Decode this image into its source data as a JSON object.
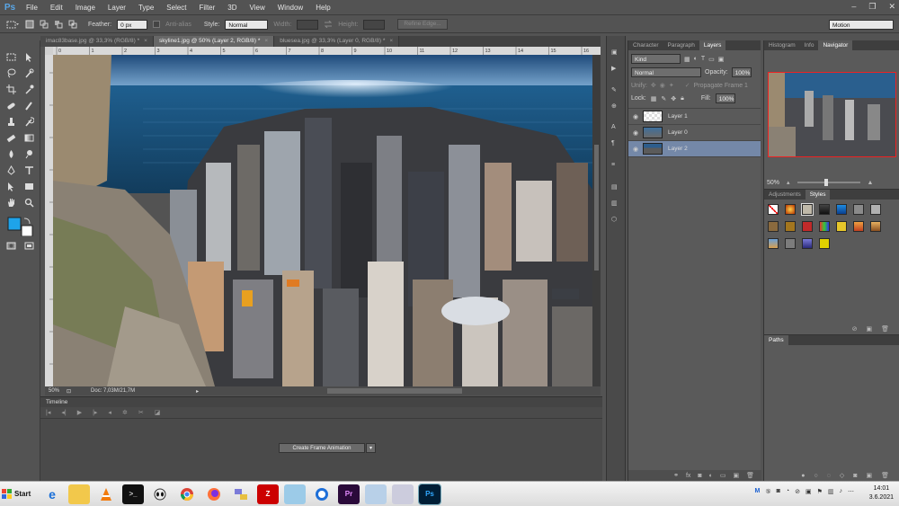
{
  "app": {
    "logo": "Ps"
  },
  "menu": [
    "File",
    "Edit",
    "Image",
    "Layer",
    "Type",
    "Select",
    "Filter",
    "3D",
    "View",
    "Window",
    "Help"
  ],
  "window_controls": [
    "–",
    "❐",
    "✕"
  ],
  "options": {
    "feather_label": "Feather:",
    "feather_value": "0 px",
    "antialias_label": "Anti-alias",
    "style_label": "Style:",
    "style_value": "Normal",
    "width_label": "Width:",
    "height_label": "Height:",
    "refine_edge": "Refine Edge...",
    "workspace": "Motion"
  },
  "doc_tabs": [
    {
      "label": "imac83base.jpg @ 33,3% (RGB/8) *",
      "active": false
    },
    {
      "label": "skyline1.jpg @ 50% (Layer 2, RGB/8) *",
      "active": true
    },
    {
      "label": "bluesea.jpg @ 33,3% (Layer 0, RGB/8) *",
      "active": false
    }
  ],
  "ruler_ticks": [
    "0",
    "1",
    "2",
    "3",
    "4",
    "5",
    "6",
    "7",
    "8",
    "9",
    "10",
    "11",
    "12",
    "13",
    "14",
    "15",
    "16"
  ],
  "status": {
    "zoom": "50%",
    "doc": "Doc: 7,03M/21,7M"
  },
  "timeline": {
    "title": "Timeline",
    "create_button": "Create Frame Animation"
  },
  "layers_panel": {
    "tabs": [
      {
        "label": "Character",
        "active": false
      },
      {
        "label": "Paragraph",
        "active": false
      },
      {
        "label": "Layers",
        "active": true
      }
    ],
    "kind_label": "Kind",
    "blend_mode": "Normal",
    "opacity_label": "Opacity:",
    "opacity_value": "100%",
    "unify_label": "Unify:",
    "propagate_label": "Propagate Frame 1",
    "lock_label": "Lock:",
    "fill_label": "Fill:",
    "fill_value": "100%",
    "layers": [
      {
        "name": "Layer 1",
        "selected": false
      },
      {
        "name": "Layer 0",
        "selected": false
      },
      {
        "name": "Layer 2",
        "selected": true
      }
    ]
  },
  "nav_panel": {
    "tabs": [
      {
        "label": "Histogram",
        "active": false
      },
      {
        "label": "Info",
        "active": false
      },
      {
        "label": "Navigator",
        "active": true
      }
    ],
    "zoom": "50%"
  },
  "styles_panel": {
    "tabs": [
      {
        "label": "Adjustments",
        "active": false
      },
      {
        "label": "Styles",
        "active": true
      }
    ]
  },
  "paths_panel": {
    "title": "Paths"
  },
  "taskbar": {
    "start": "Start",
    "clock_time": "14:01",
    "clock_date": "3.6.2021"
  }
}
